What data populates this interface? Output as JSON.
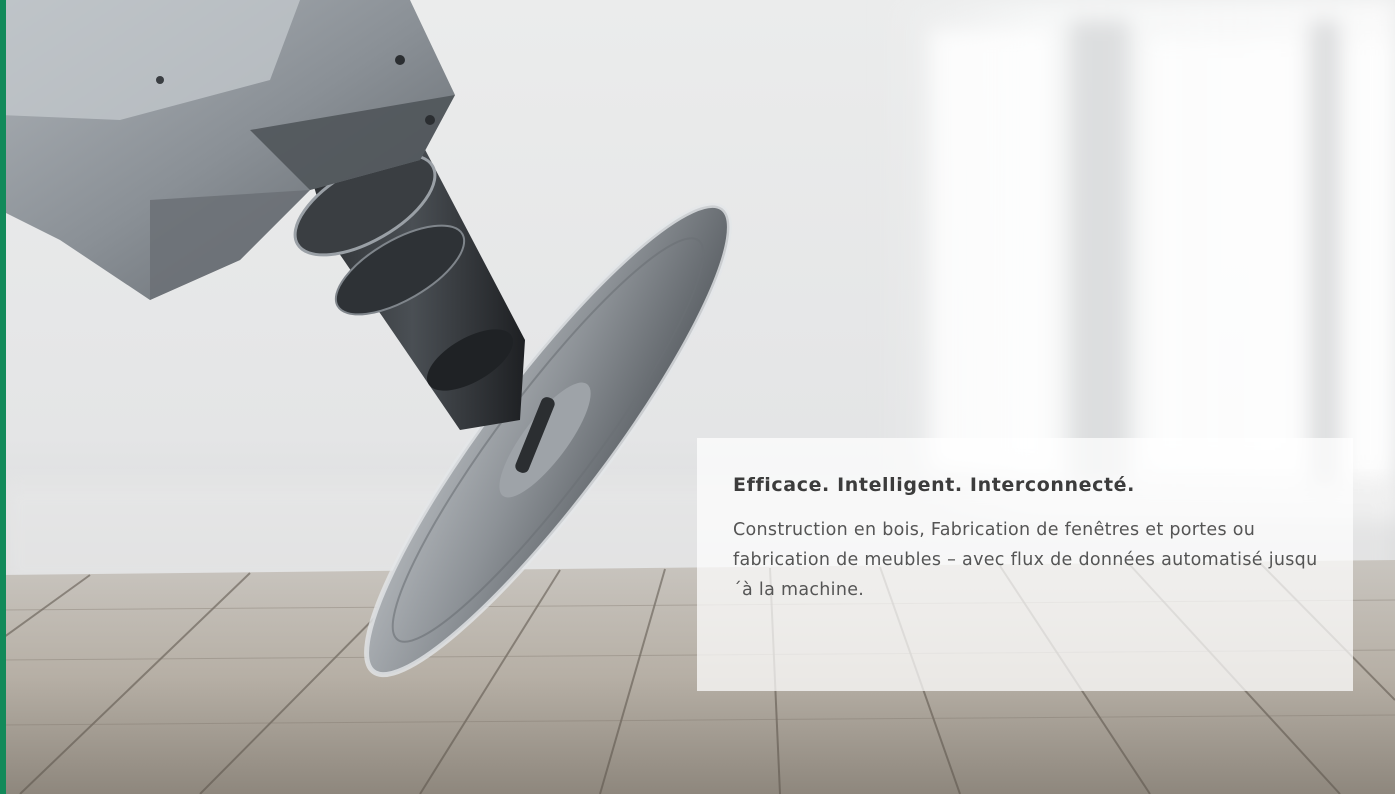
{
  "hero": {
    "image": {
      "subject": "robotic-saw-blade-over-wooden-floor"
    },
    "caption": {
      "title": "Efficace. Intelligent. Interconnecté.",
      "text": "Construction en bois, Fabrication de fenêtres et portes ou fabrication de meubles – avec flux de données automatisé jusqu´à la machine."
    }
  },
  "colors": {
    "accent": "#128a5a",
    "caption_background": "#ffffff",
    "title_text": "#3c3c3c",
    "body_text": "#555555"
  }
}
